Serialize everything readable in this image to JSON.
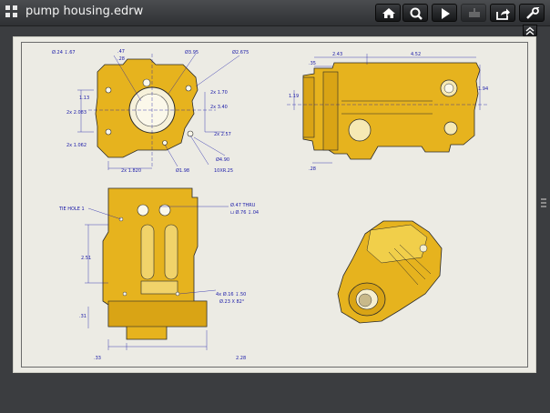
{
  "window": {
    "title": "pump housing.edrw"
  },
  "toolbar": {
    "buttons": [
      {
        "name": "home-button",
        "icon": "home-icon"
      },
      {
        "name": "zoom-button",
        "icon": "magnifier-icon"
      },
      {
        "name": "play-button",
        "icon": "play-icon"
      },
      {
        "name": "measure-button",
        "icon": "ruler-icon",
        "disabled": true
      },
      {
        "name": "share-button",
        "icon": "share-icon"
      },
      {
        "name": "tools-button",
        "icon": "wrench-icon"
      }
    ],
    "collapse_icon": "chevron-double-up-icon"
  },
  "colors": {
    "part": "#e6b31e",
    "dim_text": "#1a1aa8",
    "canvas": "#ecebe4"
  },
  "drawing": {
    "front": {
      "d1": "Ø.24 ↧.67",
      "d2": ".47",
      "d3": ".28",
      "d4": "Ø3.95",
      "d5": "Ø2.675",
      "d6": "1.13",
      "d7": "2x 2.083",
      "d8": "2x 1.062",
      "d9": "2x 1.70",
      "d10": "2x 3.40",
      "d11": "2x 2.57",
      "d12": "Ø4.90",
      "d13": "2x 1.820",
      "d14": "Ø1.98",
      "d15": "10XR.25"
    },
    "side": {
      "d1": "2.43",
      "d2": "4.52",
      "d3": ".35",
      "d4": "1.19",
      "d5": "1.94",
      "d6": ".28"
    },
    "bottom": {
      "d1": "TIE HOLE 1",
      "d2": "Ø.47 THRU",
      "d3": "⊔ Ø.76 ↧.04",
      "d4": "2.51",
      "d5": "4x Ø.16 ↧.50",
      "d6": "Ø.23 X 82°",
      "d7": ".31",
      "d8": ".33",
      "d9": "2.28"
    }
  }
}
